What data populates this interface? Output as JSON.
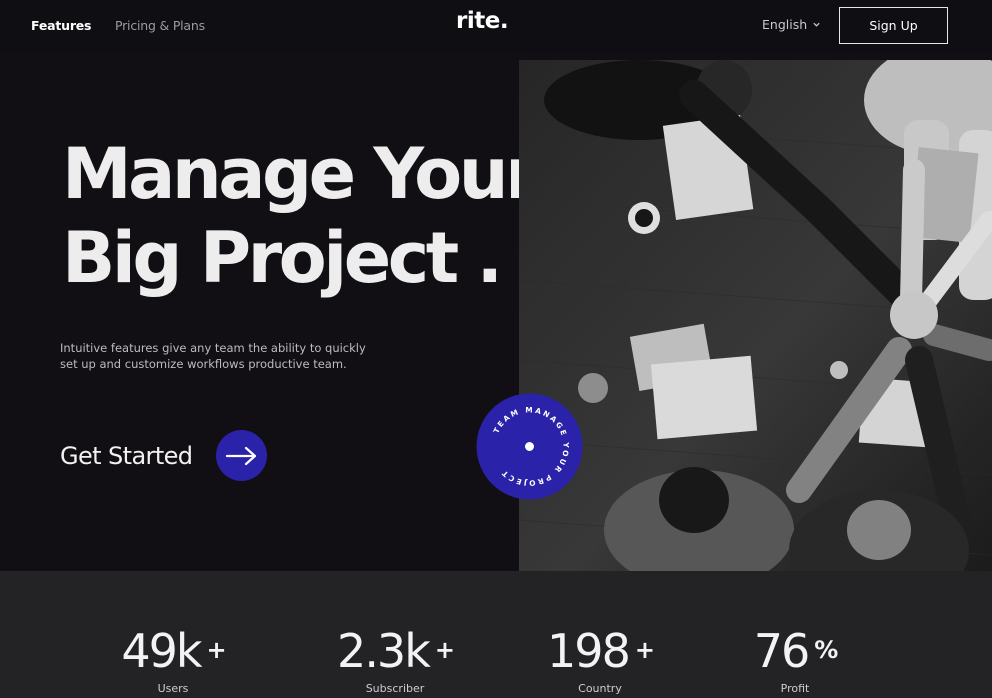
{
  "nav": {
    "features": "Features",
    "pricing": "Pricing & Plans",
    "logo": "rite.",
    "language": "English",
    "signup": "Sign Up"
  },
  "hero": {
    "headline_line1": "Manage Your",
    "headline_line2": "Big Project .",
    "subtext": "Intuitive features give any team the ability to quickly set up and customize workflows productive team.",
    "cta": "Get Started",
    "badge_text": "TEAM MANAGE YOUR PROJECT"
  },
  "stats": [
    {
      "value": "49k",
      "suffix": "+",
      "label": "Users"
    },
    {
      "value": "2.3k",
      "suffix": "+",
      "label": "Subscriber"
    },
    {
      "value": "198",
      "suffix": "+",
      "label": "Country"
    },
    {
      "value": "76",
      "suffix": "%",
      "label": "Profit"
    }
  ],
  "colors": {
    "background": "#110f13",
    "accent": "#2a22a8",
    "stats_band": "#232225"
  },
  "icons": [
    "chevron-down-icon",
    "arrow-right-icon"
  ]
}
